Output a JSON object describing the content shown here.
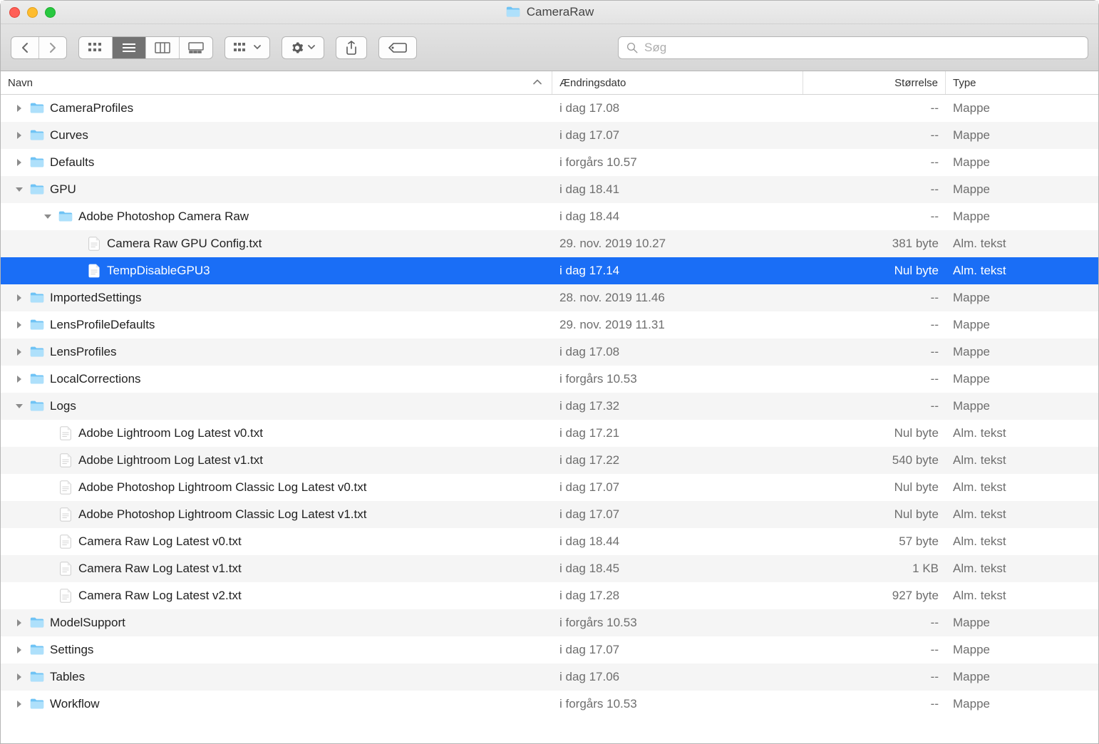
{
  "window": {
    "title": "CameraRaw"
  },
  "search": {
    "placeholder": "Søg"
  },
  "columns": {
    "name": "Navn",
    "date": "Ændringsdato",
    "size": "Størrelse",
    "type": "Type"
  },
  "rows": [
    {
      "indent": 0,
      "kind": "folder",
      "expanded": false,
      "name": "CameraProfiles",
      "date": "i dag 17.08",
      "size": "--",
      "type": "Mappe",
      "selected": false,
      "alt": false
    },
    {
      "indent": 0,
      "kind": "folder",
      "expanded": false,
      "name": "Curves",
      "date": "i dag 17.07",
      "size": "--",
      "type": "Mappe",
      "selected": false,
      "alt": true
    },
    {
      "indent": 0,
      "kind": "folder",
      "expanded": false,
      "name": "Defaults",
      "date": "i forgårs 10.57",
      "size": "--",
      "type": "Mappe",
      "selected": false,
      "alt": false
    },
    {
      "indent": 0,
      "kind": "folder",
      "expanded": true,
      "name": "GPU",
      "date": "i dag 18.41",
      "size": "--",
      "type": "Mappe",
      "selected": false,
      "alt": true
    },
    {
      "indent": 1,
      "kind": "folder",
      "expanded": true,
      "name": "Adobe Photoshop Camera Raw",
      "date": "i dag 18.44",
      "size": "--",
      "type": "Mappe",
      "selected": false,
      "alt": false
    },
    {
      "indent": 2,
      "kind": "file",
      "expanded": null,
      "name": "Camera Raw GPU Config.txt",
      "date": "29. nov. 2019 10.27",
      "size": "381 byte",
      "type": "Alm. tekst",
      "selected": false,
      "alt": true
    },
    {
      "indent": 2,
      "kind": "file",
      "expanded": null,
      "name": "TempDisableGPU3",
      "date": "i dag 17.14",
      "size": "Nul byte",
      "type": "Alm. tekst",
      "selected": true,
      "alt": false
    },
    {
      "indent": 0,
      "kind": "folder",
      "expanded": false,
      "name": "ImportedSettings",
      "date": "28. nov. 2019 11.46",
      "size": "--",
      "type": "Mappe",
      "selected": false,
      "alt": true
    },
    {
      "indent": 0,
      "kind": "folder",
      "expanded": false,
      "name": "LensProfileDefaults",
      "date": "29. nov. 2019 11.31",
      "size": "--",
      "type": "Mappe",
      "selected": false,
      "alt": false
    },
    {
      "indent": 0,
      "kind": "folder",
      "expanded": false,
      "name": "LensProfiles",
      "date": "i dag 17.08",
      "size": "--",
      "type": "Mappe",
      "selected": false,
      "alt": true
    },
    {
      "indent": 0,
      "kind": "folder",
      "expanded": false,
      "name": "LocalCorrections",
      "date": "i forgårs 10.53",
      "size": "--",
      "type": "Mappe",
      "selected": false,
      "alt": false
    },
    {
      "indent": 0,
      "kind": "folder",
      "expanded": true,
      "name": "Logs",
      "date": "i dag 17.32",
      "size": "--",
      "type": "Mappe",
      "selected": false,
      "alt": true
    },
    {
      "indent": 1,
      "kind": "file",
      "expanded": null,
      "name": "Adobe Lightroom Log Latest v0.txt",
      "date": "i dag 17.21",
      "size": "Nul byte",
      "type": "Alm. tekst",
      "selected": false,
      "alt": false
    },
    {
      "indent": 1,
      "kind": "file",
      "expanded": null,
      "name": "Adobe Lightroom Log Latest v1.txt",
      "date": "i dag 17.22",
      "size": "540 byte",
      "type": "Alm. tekst",
      "selected": false,
      "alt": true
    },
    {
      "indent": 1,
      "kind": "file",
      "expanded": null,
      "name": "Adobe Photoshop Lightroom Classic Log Latest v0.txt",
      "date": "i dag 17.07",
      "size": "Nul byte",
      "type": "Alm. tekst",
      "selected": false,
      "alt": false
    },
    {
      "indent": 1,
      "kind": "file",
      "expanded": null,
      "name": "Adobe Photoshop Lightroom Classic Log Latest v1.txt",
      "date": "i dag 17.07",
      "size": "Nul byte",
      "type": "Alm. tekst",
      "selected": false,
      "alt": true
    },
    {
      "indent": 1,
      "kind": "file",
      "expanded": null,
      "name": "Camera Raw Log Latest v0.txt",
      "date": "i dag 18.44",
      "size": "57 byte",
      "type": "Alm. tekst",
      "selected": false,
      "alt": false
    },
    {
      "indent": 1,
      "kind": "file",
      "expanded": null,
      "name": "Camera Raw Log Latest v1.txt",
      "date": "i dag 18.45",
      "size": "1 KB",
      "type": "Alm. tekst",
      "selected": false,
      "alt": true
    },
    {
      "indent": 1,
      "kind": "file",
      "expanded": null,
      "name": "Camera Raw Log Latest v2.txt",
      "date": "i dag 17.28",
      "size": "927 byte",
      "type": "Alm. tekst",
      "selected": false,
      "alt": false
    },
    {
      "indent": 0,
      "kind": "folder",
      "expanded": false,
      "name": "ModelSupport",
      "date": "i forgårs 10.53",
      "size": "--",
      "type": "Mappe",
      "selected": false,
      "alt": true
    },
    {
      "indent": 0,
      "kind": "folder",
      "expanded": false,
      "name": "Settings",
      "date": "i dag 17.07",
      "size": "--",
      "type": "Mappe",
      "selected": false,
      "alt": false
    },
    {
      "indent": 0,
      "kind": "folder",
      "expanded": false,
      "name": "Tables",
      "date": "i dag 17.06",
      "size": "--",
      "type": "Mappe",
      "selected": false,
      "alt": true
    },
    {
      "indent": 0,
      "kind": "folder",
      "expanded": false,
      "name": "Workflow",
      "date": "i forgårs 10.53",
      "size": "--",
      "type": "Mappe",
      "selected": false,
      "alt": false
    }
  ]
}
